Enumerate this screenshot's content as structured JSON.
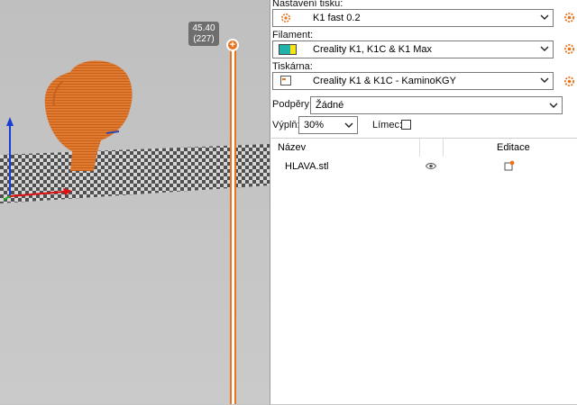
{
  "viewport": {
    "layer_height": "45.40",
    "layer_index": "(227)"
  },
  "panel": {
    "print_settings_label": "Nastavení tisku:",
    "print_settings_value": "K1 fast 0.2",
    "filament_label": "Filament:",
    "filament_value": "Creality K1, K1C & K1 Max",
    "filament_colors": [
      "#1fb3a9",
      "#f7e316"
    ],
    "printer_label": "Tiskárna:",
    "printer_value": "Creality K1 & K1C - KaminoKGY",
    "supports_label": "Podpěry:",
    "supports_value": "Žádné",
    "infill_label": "Výplň:",
    "infill_value": "30%",
    "brim_label": "Límec:",
    "brim_checked": false,
    "list": {
      "col_name": "Název",
      "col_edit": "Editace",
      "objects": [
        {
          "name": "HLAVA.stl",
          "visible_icon": "eye-icon",
          "edit_icon": "edit-settings-icon"
        }
      ]
    },
    "accent_color": "#e8741e"
  }
}
